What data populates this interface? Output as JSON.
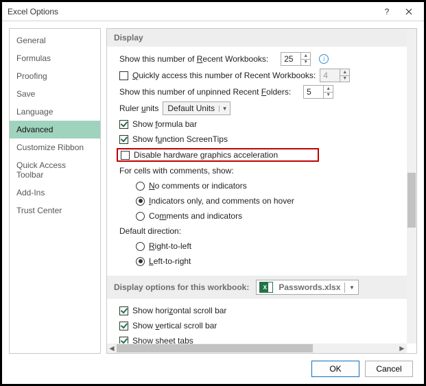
{
  "window": {
    "title": "Excel Options"
  },
  "sidebar": {
    "items": [
      {
        "label": "General"
      },
      {
        "label": "Formulas"
      },
      {
        "label": "Proofing"
      },
      {
        "label": "Save"
      },
      {
        "label": "Language"
      },
      {
        "label": "Advanced",
        "selected": true
      },
      {
        "label": "Customize Ribbon"
      },
      {
        "label": "Quick Access Toolbar"
      },
      {
        "label": "Add-Ins"
      },
      {
        "label": "Trust Center"
      }
    ]
  },
  "display": {
    "header": "Display",
    "recent_workbooks_label_pre": "Show this number of ",
    "recent_workbooks_label_under": "R",
    "recent_workbooks_label_post": "ecent Workbooks:",
    "recent_workbooks_value": "25",
    "quick_access_pre": "",
    "quick_access_under": "Q",
    "quick_access_post": "uickly access this number of Recent Workbooks:",
    "quick_access_checked": false,
    "quick_access_value": "4",
    "unpinned_label_pre": "Show this number of unpinned Recent ",
    "unpinned_label_under": "F",
    "unpinned_label_post": "olders:",
    "unpinned_value": "5",
    "ruler_units_label_pre": "Ruler ",
    "ruler_units_label_under": "u",
    "ruler_units_label_post": "nits",
    "ruler_units_value": "Default Units",
    "show_formula_bar_pre": "Show ",
    "show_formula_bar_under": "f",
    "show_formula_bar_post": "ormula bar",
    "show_formula_bar_checked": true,
    "show_screentips_pre": "Show f",
    "show_screentips_under": "u",
    "show_screentips_post": "nction ScreenTips",
    "show_screentips_checked": true,
    "disable_hw_label": "Disable hardware graphics acceleration",
    "disable_hw_checked": false,
    "comments_header": "For cells with comments, show:",
    "comments_opt1_under": "N",
    "comments_opt1_post": "o comments or indicators",
    "comments_opt2_under": "I",
    "comments_opt2_post": "ndicators only, and comments on hover",
    "comments_opt3_pre": "Co",
    "comments_opt3_under": "m",
    "comments_opt3_post": "ments and indicators",
    "comments_selected": 1,
    "direction_header": "Default direction:",
    "direction_opt1_under": "R",
    "direction_opt1_post": "ight-to-left",
    "direction_opt2_under": "L",
    "direction_opt2_post": "eft-to-right",
    "direction_selected": 1
  },
  "workbook_section": {
    "header": "Display options for this workbook:",
    "workbook_name": "Passwords.xlsx",
    "hscroll_label_pre": "Show hori",
    "hscroll_label_under": "z",
    "hscroll_label_post": "ontal scroll bar",
    "hscroll_checked": true,
    "vscroll_label_pre": "Show ",
    "vscroll_label_under": "v",
    "vscroll_label_post": "ertical scroll bar",
    "vscroll_checked": true,
    "tabs_label_pre": "Show sheet ",
    "tabs_label_under": "t",
    "tabs_label_post": "abs",
    "tabs_checked": true
  },
  "footer": {
    "ok": "OK",
    "cancel": "Cancel"
  }
}
